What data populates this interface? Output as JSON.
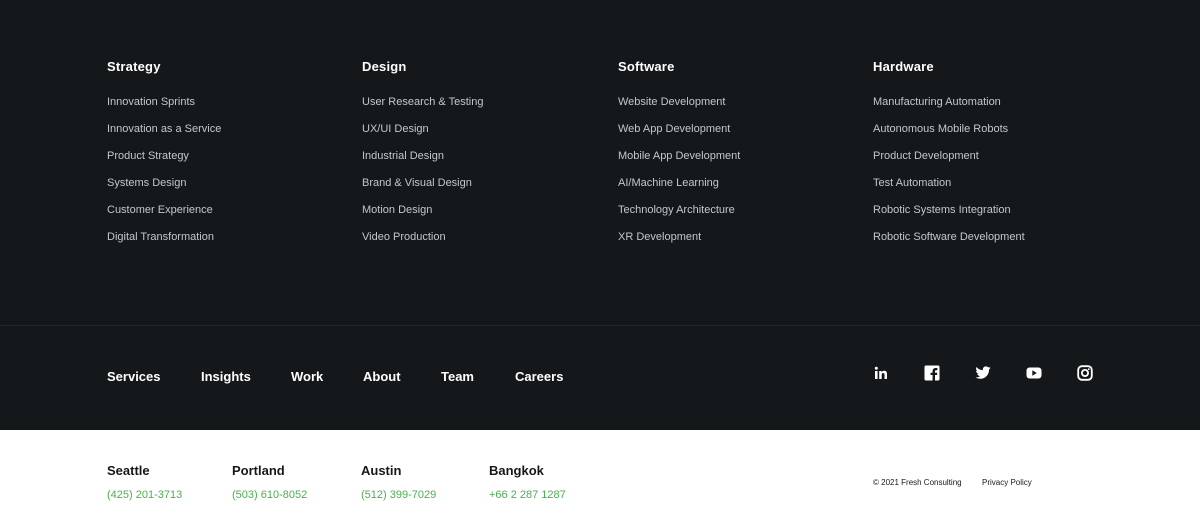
{
  "columns": [
    {
      "title": "Strategy",
      "items": [
        "Innovation Sprints",
        "Innovation as a Service",
        "Product Strategy",
        "Systems Design",
        "Customer Experience",
        "Digital Transformation"
      ]
    },
    {
      "title": "Design",
      "items": [
        "User Research & Testing",
        "UX/UI Design",
        "Industrial Design",
        "Brand & Visual Design",
        "Motion Design",
        "Video Production"
      ]
    },
    {
      "title": "Software",
      "items": [
        "Website Development",
        "Web App Development",
        "Mobile App Development",
        "AI/Machine Learning",
        "Technology Architecture",
        "XR Development"
      ]
    },
    {
      "title": "Hardware",
      "items": [
        "Manufacturing Automation",
        "Autonomous Mobile Robots",
        "Product Development",
        "Test Automation",
        "Robotic Systems Integration",
        "Robotic Software Development"
      ]
    }
  ],
  "nav": [
    "Services",
    "Insights",
    "Work",
    "About",
    "Team",
    "Careers"
  ],
  "social": [
    "linkedin-icon",
    "facebook-icon",
    "twitter-icon",
    "youtube-icon",
    "instagram-icon"
  ],
  "offices": [
    {
      "city": "Seattle",
      "phone": "(425) 201-3713"
    },
    {
      "city": "Portland",
      "phone": "(503) 610-8052"
    },
    {
      "city": "Austin",
      "phone": "(512) 399-7029"
    },
    {
      "city": "Bangkok",
      "phone": "+66 2 287 1287"
    }
  ],
  "legal": {
    "copyright": "© 2021 Fresh Consulting",
    "privacy": "Privacy Policy"
  },
  "colors": {
    "dark_background": "#15181b",
    "phone_green": "#4caf50",
    "link_gray": "#c4c7ca"
  }
}
